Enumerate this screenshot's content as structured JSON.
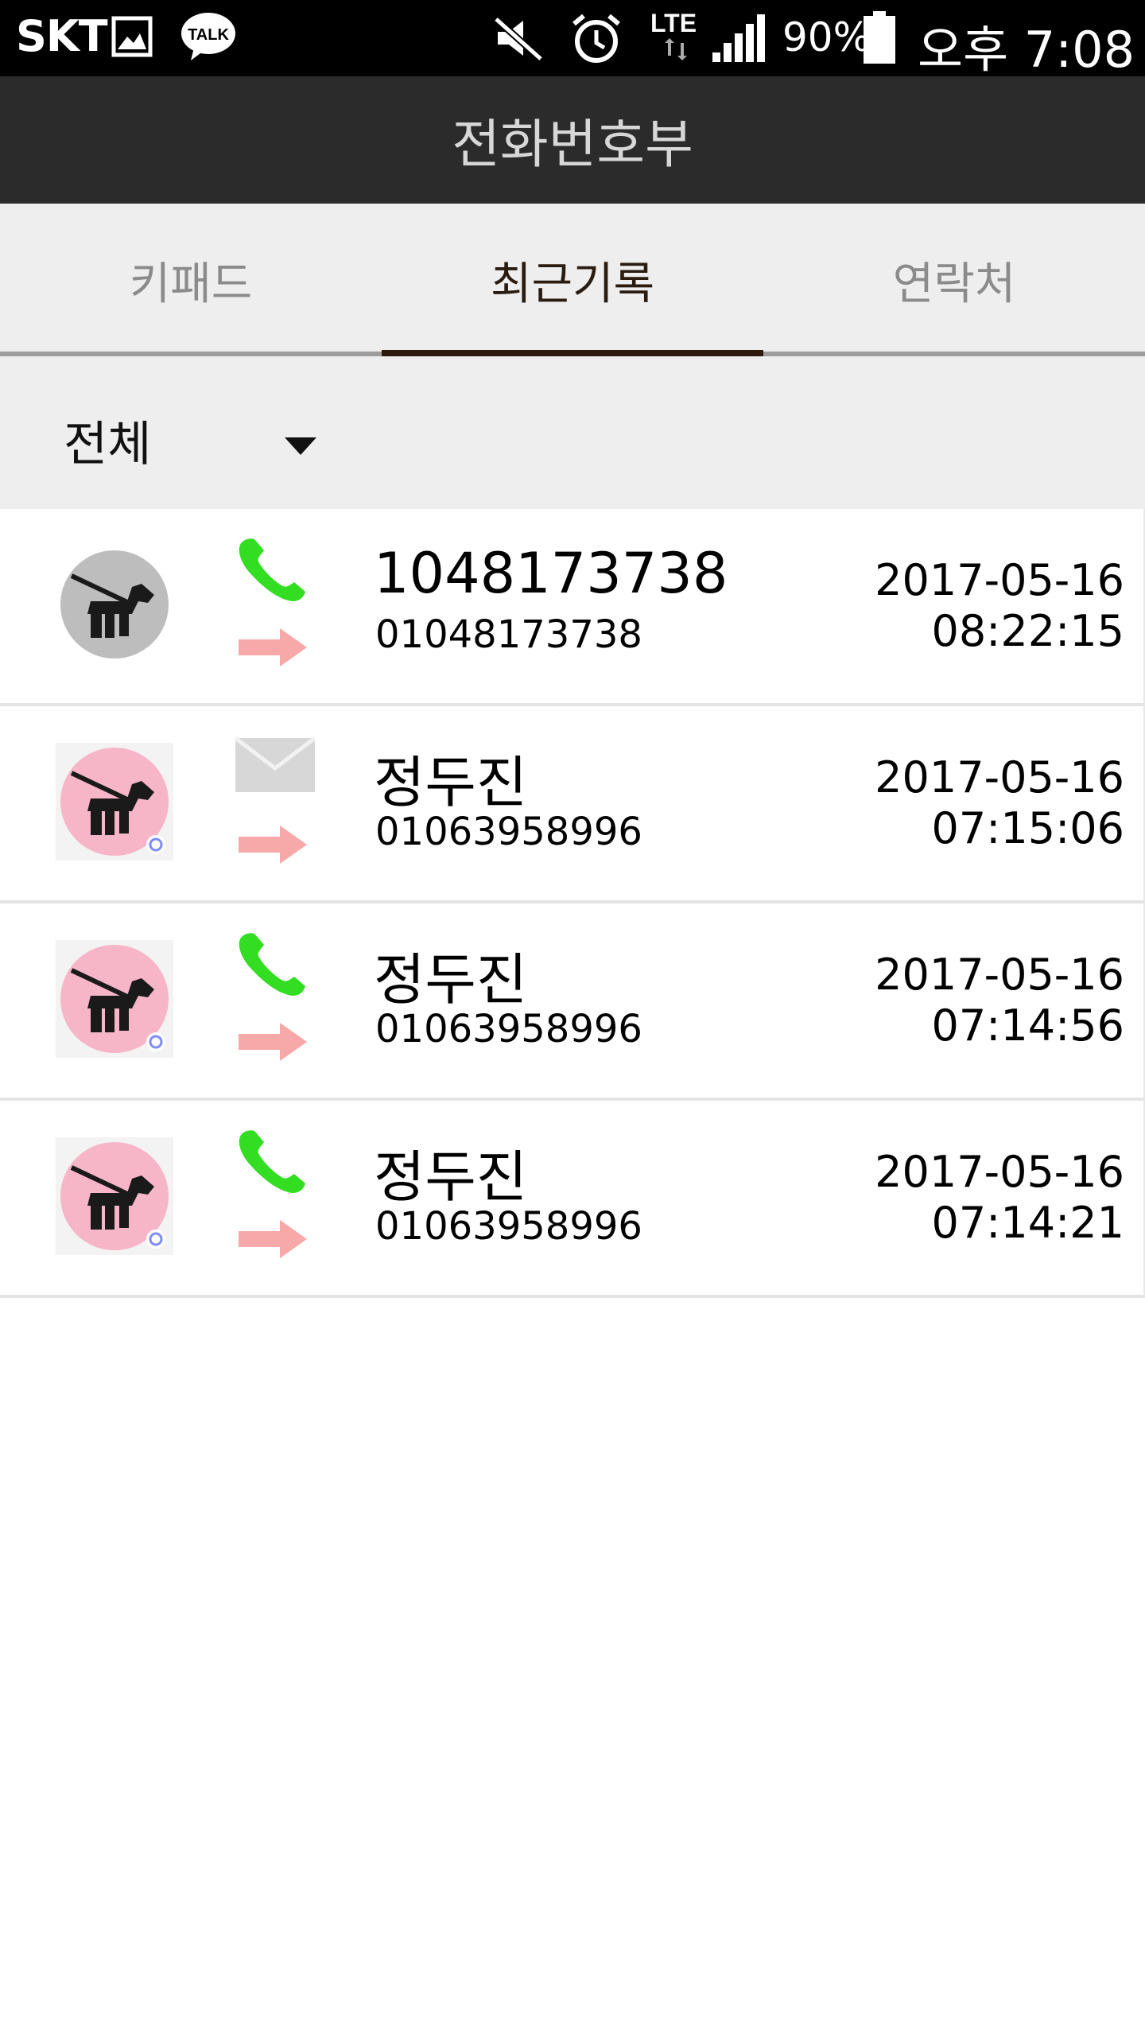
{
  "status_bar": {
    "carrier": "SKT",
    "battery_percent": "90%",
    "time": "오후 7:08",
    "network": "LTE",
    "icons": [
      "image-icon",
      "kakaotalk-icon",
      "mute-icon",
      "alarm-icon",
      "lte-icon",
      "signal-icon",
      "battery-icon"
    ]
  },
  "app_bar": {
    "title": "전화번호부"
  },
  "tabs": [
    {
      "label": "키패드",
      "active": false
    },
    {
      "label": "최근기록",
      "active": true
    },
    {
      "label": "연락처",
      "active": false
    }
  ],
  "filter": {
    "selected": "전체"
  },
  "colors": {
    "status_bg": "#000000",
    "appbar_bg": "#2b2b2b",
    "tab_bg": "#eeeeee",
    "tab_indicator": "#2d1a0c",
    "call_green": "#33dd22",
    "arrow_pink": "#f7a8a8",
    "avatar_pink": "#f7b6c8",
    "avatar_gray": "#bdbdbd"
  },
  "call_log": [
    {
      "name": "1048173738",
      "number": "01048173738",
      "date": "2017-05-16",
      "time": "08:22:15",
      "type": "phone-call",
      "direction": "outgoing",
      "avatar": "gray"
    },
    {
      "name": "정두진",
      "number": "01063958996",
      "date": "2017-05-16",
      "time": "07:15:06",
      "type": "message",
      "direction": "outgoing",
      "avatar": "pink"
    },
    {
      "name": "정두진",
      "number": "01063958996",
      "date": "2017-05-16",
      "time": "07:14:56",
      "type": "phone-call",
      "direction": "outgoing",
      "avatar": "pink"
    },
    {
      "name": "정두진",
      "number": "01063958996",
      "date": "2017-05-16",
      "time": "07:14:21",
      "type": "phone-call",
      "direction": "outgoing",
      "avatar": "pink"
    }
  ]
}
